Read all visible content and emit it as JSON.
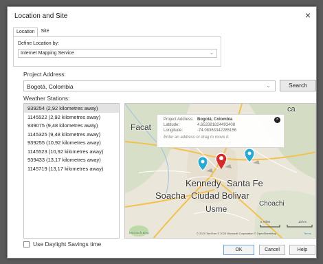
{
  "window": {
    "title": "Location and Site",
    "close_glyph": "×"
  },
  "tabs": [
    {
      "label": "Location"
    },
    {
      "label": "Site"
    }
  ],
  "define_location": {
    "label": "Define Location by:",
    "value": "Internet Mapping Service"
  },
  "project_address": {
    "label": "Project Address:",
    "value": "Bogotá, Colombia",
    "search_label": "Search"
  },
  "weather": {
    "label": "Weather Stations:",
    "stations": [
      "939254 (2,92 kilometres away)",
      "1145522 (2,92 kilometres away)",
      "939075 (9,48 kilometres away)",
      "1145325 (9,48 kilometres away)",
      "939255 (10,92 kilometres away)",
      "1145523 (10,92 kilometres away)",
      "939433 (13,17 kilometres away)",
      "1145719 (13,17 kilometres away)"
    ],
    "selected_index": 0
  },
  "map": {
    "callout": {
      "address_key": "Project Address:",
      "address_val": "Bogotá, Colombia",
      "lat_key": "Latitude:",
      "lat_val": "4.653381824493408",
      "lon_key": "Longitude:",
      "lon_val": "-74.08363342285156",
      "hint": "Enter an address or drag to move it.",
      "close_glyph": "×"
    },
    "places": {
      "facat": "Facat",
      "kennedy": "Kennedy",
      "santa_fe": "Santa Fe",
      "soacha": "Soacha",
      "ciudad_bolivar": "Ciudad Bolivar",
      "choachi": "Choachi",
      "usme": "Usme",
      "ca": "ca"
    },
    "scale": {
      "miles": "5 miles",
      "km": "10 km"
    },
    "attribution": "© 2020 TomTom © 2020 Microsoft Corporation © OpenStreetMap",
    "terms": "Terms",
    "brand": "Microsoft Bing"
  },
  "dst": {
    "label": "Use Daylight Savings time"
  },
  "buttons": {
    "ok": "OK",
    "cancel": "Cancel",
    "help": "Help"
  },
  "colors": {
    "accent": "#1e6fd0",
    "selected_pin": "#d42a2a",
    "station_pin": "#2aa8d4"
  }
}
